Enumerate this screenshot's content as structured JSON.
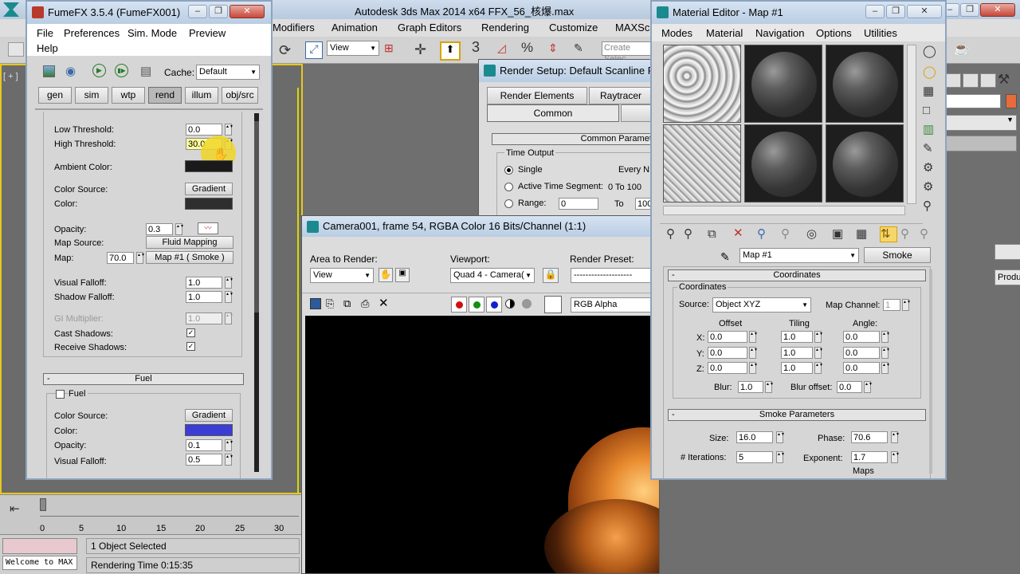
{
  "app_title": "Autodesk 3ds Max  2014 x64       FFX_56_核爆.max",
  "main_menu": [
    "Modifiers",
    "Animation",
    "Graph Editors",
    "Rendering",
    "Customize",
    "MAXSc"
  ],
  "viewport": {
    "toolbar_select": "View",
    "create_selection": "Create Selec",
    "label": "[ + ]",
    "quick_digit": "3"
  },
  "timeline": {
    "ticks": [
      "0",
      "5",
      "10",
      "15",
      "20",
      "25",
      "30"
    ]
  },
  "status": {
    "maxscript": "Welcome to MAX",
    "selected": "1 Object Selected",
    "render_time": "Rendering Time  0:15:35"
  },
  "fumefx": {
    "title": "FumeFX 3.5.4 (FumeFX001)",
    "menu": [
      "File",
      "Preferences",
      "Sim. Mode",
      "Preview",
      "Help"
    ],
    "cache_label": "Cache:",
    "cache_value": "Default",
    "tabs": [
      "gen",
      "sim",
      "wtp",
      "rend",
      "illum",
      "obj/src"
    ],
    "active_tab": "rend",
    "low_threshold_label": "Low Threshold:",
    "low_threshold": "0.0",
    "high_threshold_label": "High Threshold:",
    "high_threshold": "30.0",
    "ambient_label": "Ambient Color:",
    "ambient_color": "#1a1a1a",
    "color_source_label": "Color Source:",
    "color_source": "Gradient",
    "color_label": "Color:",
    "color": "#2e2e2e",
    "opacity_label": "Opacity:",
    "opacity": "0.3",
    "map_source_label": "Map Source:",
    "map_source": "Fluid Mapping",
    "map_label": "Map:",
    "map_amount": "70.0",
    "map_name": "Map #1  ( Smoke )",
    "visual_falloff_label": "Visual Falloff:",
    "visual_falloff": "1.0",
    "shadow_falloff_label": "Shadow Falloff:",
    "shadow_falloff": "1.0",
    "gi_label": "GI Multiplier:",
    "gi_value": "1.0",
    "cast_label": "Cast Shadows:",
    "receive_label": "Receive Shadows:",
    "fuel_header": "Fuel",
    "fuel_checkbox": "Fuel",
    "fuel_color_source_label": "Color Source:",
    "fuel_color_source": "Gradient",
    "fuel_color_label": "Color:",
    "fuel_color": "#3c3cd6",
    "fuel_opacity_label": "Opacity:",
    "fuel_opacity": "0.1",
    "fuel_falloff_label": "Visual Falloff:",
    "fuel_falloff": "0.5"
  },
  "render_setup": {
    "title": "Render Setup: Default Scanline R",
    "tabs_row1": [
      "Render Elements",
      "Raytracer"
    ],
    "tabs_row2": [
      "Common"
    ],
    "common_header": "Common Paramete",
    "time_output": "Time Output",
    "single": "Single",
    "every": "Every N",
    "active_segment": "Active Time Segment:",
    "active_range": "0 To 100",
    "range": "Range:",
    "range_from": "0",
    "range_to_label": "To",
    "range_to": "100"
  },
  "frame_window": {
    "title": "Camera001, frame 54, RGBA Color 16 Bits/Channel (1:1)",
    "area_label": "Area to Render:",
    "area_value": "View",
    "viewport_label": "Viewport:",
    "viewport_value": "Quad 4 - Camera(",
    "preset_label": "Render Preset:",
    "preset_value": "--------------------",
    "channel_value": "RGB Alpha"
  },
  "material_editor": {
    "title": "Material Editor - Map #1",
    "menu": [
      "Modes",
      "Material",
      "Navigation",
      "Options",
      "Utilities"
    ],
    "map_name": "Map #1",
    "map_type": "Smoke",
    "coord_header": "Coordinates",
    "coord_group": "Coordinates",
    "source_label": "Source:",
    "source_value": "Object XYZ",
    "map_channel_label": "Map Channel:",
    "map_channel": "1",
    "offset_label": "Offset",
    "tiling_label": "Tiling",
    "angle_label": "Angle:",
    "axis": [
      "X:",
      "Y:",
      "Z:"
    ],
    "offset": [
      "0.0",
      "0.0",
      "0.0"
    ],
    "tiling": [
      "1.0",
      "1.0",
      "1.0"
    ],
    "angle": [
      "0.0",
      "0.0",
      "0.0"
    ],
    "blur_label": "Blur:",
    "blur": "1.0",
    "blur_offset_label": "Blur offset:",
    "blur_offset": "0.0",
    "smoke_header": "Smoke Parameters",
    "size_label": "Size:",
    "size": "16.0",
    "phase_label": "Phase:",
    "phase": "70.6",
    "iterations_label": "# Iterations:",
    "iterations": "5",
    "exponent_label": "Exponent:",
    "exponent": "1.7",
    "maps_label": "Maps"
  },
  "right_panel": {
    "produce": "Produc"
  }
}
